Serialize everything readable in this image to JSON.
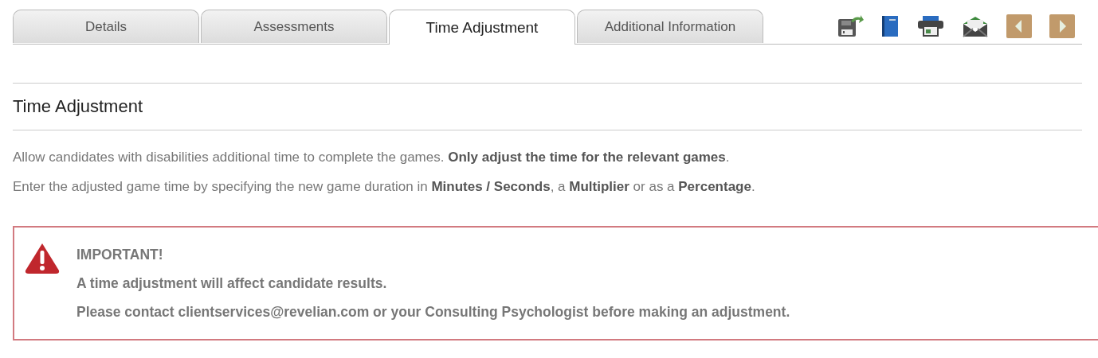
{
  "tabs": [
    {
      "label": "Details",
      "selected": false
    },
    {
      "label": "Assessments",
      "selected": false
    },
    {
      "label": "Time Adjustment",
      "selected": true
    },
    {
      "label": "Additional Information",
      "selected": false
    }
  ],
  "section": {
    "title": "Time Adjustment",
    "paragraphs": [
      "Allow candidates with disabilities additional time to complete the games. **Only adjust the time for the relevant games**.",
      "Enter the adjusted game time by specifying the new game duration in **Minutes / Seconds**, a **Multiplier** or as a **Percentage**."
    ]
  },
  "alert": {
    "kind": "warning",
    "lines": [
      "IMPORTANT!",
      "A time adjustment will affect candidate results.",
      "Please contact clientservices@revelian.com or your Consulting Psychologist before making an adjustment."
    ]
  }
}
